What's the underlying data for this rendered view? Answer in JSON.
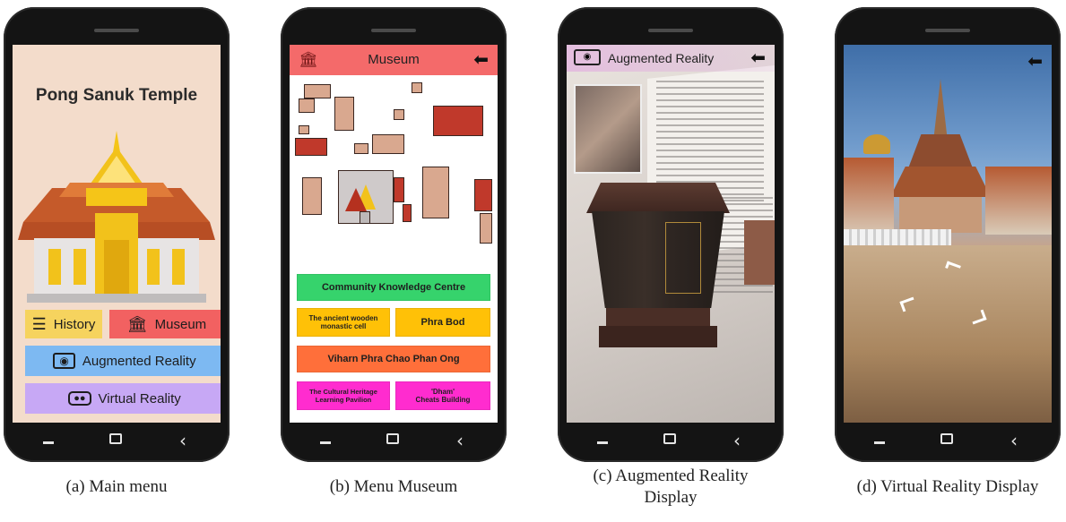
{
  "captions": {
    "a": "(a) Main menu",
    "b": "(b) Menu Museum",
    "c": "(c) Augmented Reality\nDisplay",
    "d": "(d) Virtual Reality Display"
  },
  "phone_a": {
    "title": "Pong Sanuk Temple",
    "buttons": {
      "history": "History",
      "museum": "Museum",
      "augmented": "Augmented Reality",
      "virtual": "Virtual Reality"
    },
    "colors": {
      "history": "#f6d35e",
      "museum": "#f26161",
      "augmented": "#7db9f2",
      "virtual": "#c7a8f5"
    },
    "icons": {
      "history": "books-icon",
      "museum": "museum-icon",
      "augmented": "ar-camera-icon",
      "virtual": "vr-goggles-icon"
    }
  },
  "phone_b": {
    "header_title": "Museum",
    "tabs": {
      "community": "Community Knowledge Centre",
      "wooden_cell": "The ancient wooden\nmonastic cell",
      "phra_bod": "Phra Bod",
      "viharn": "Viharn Phra Chao Phan Ong",
      "pavilion": "The Cultural Heritage\nLearning Pavilion",
      "cheats": "'Dham'\nCheats Building"
    },
    "colors": {
      "header": "#f46a6a",
      "community": "#36d36c",
      "wooden_cell": "#ffc107",
      "phra_bod": "#ffc107",
      "viharn": "#ff6f3a",
      "pavilion": "#ff2ccf",
      "cheats": "#ff2ccf"
    }
  },
  "phone_c": {
    "header_title": "Augmented Reality"
  },
  "phone_d": {}
}
